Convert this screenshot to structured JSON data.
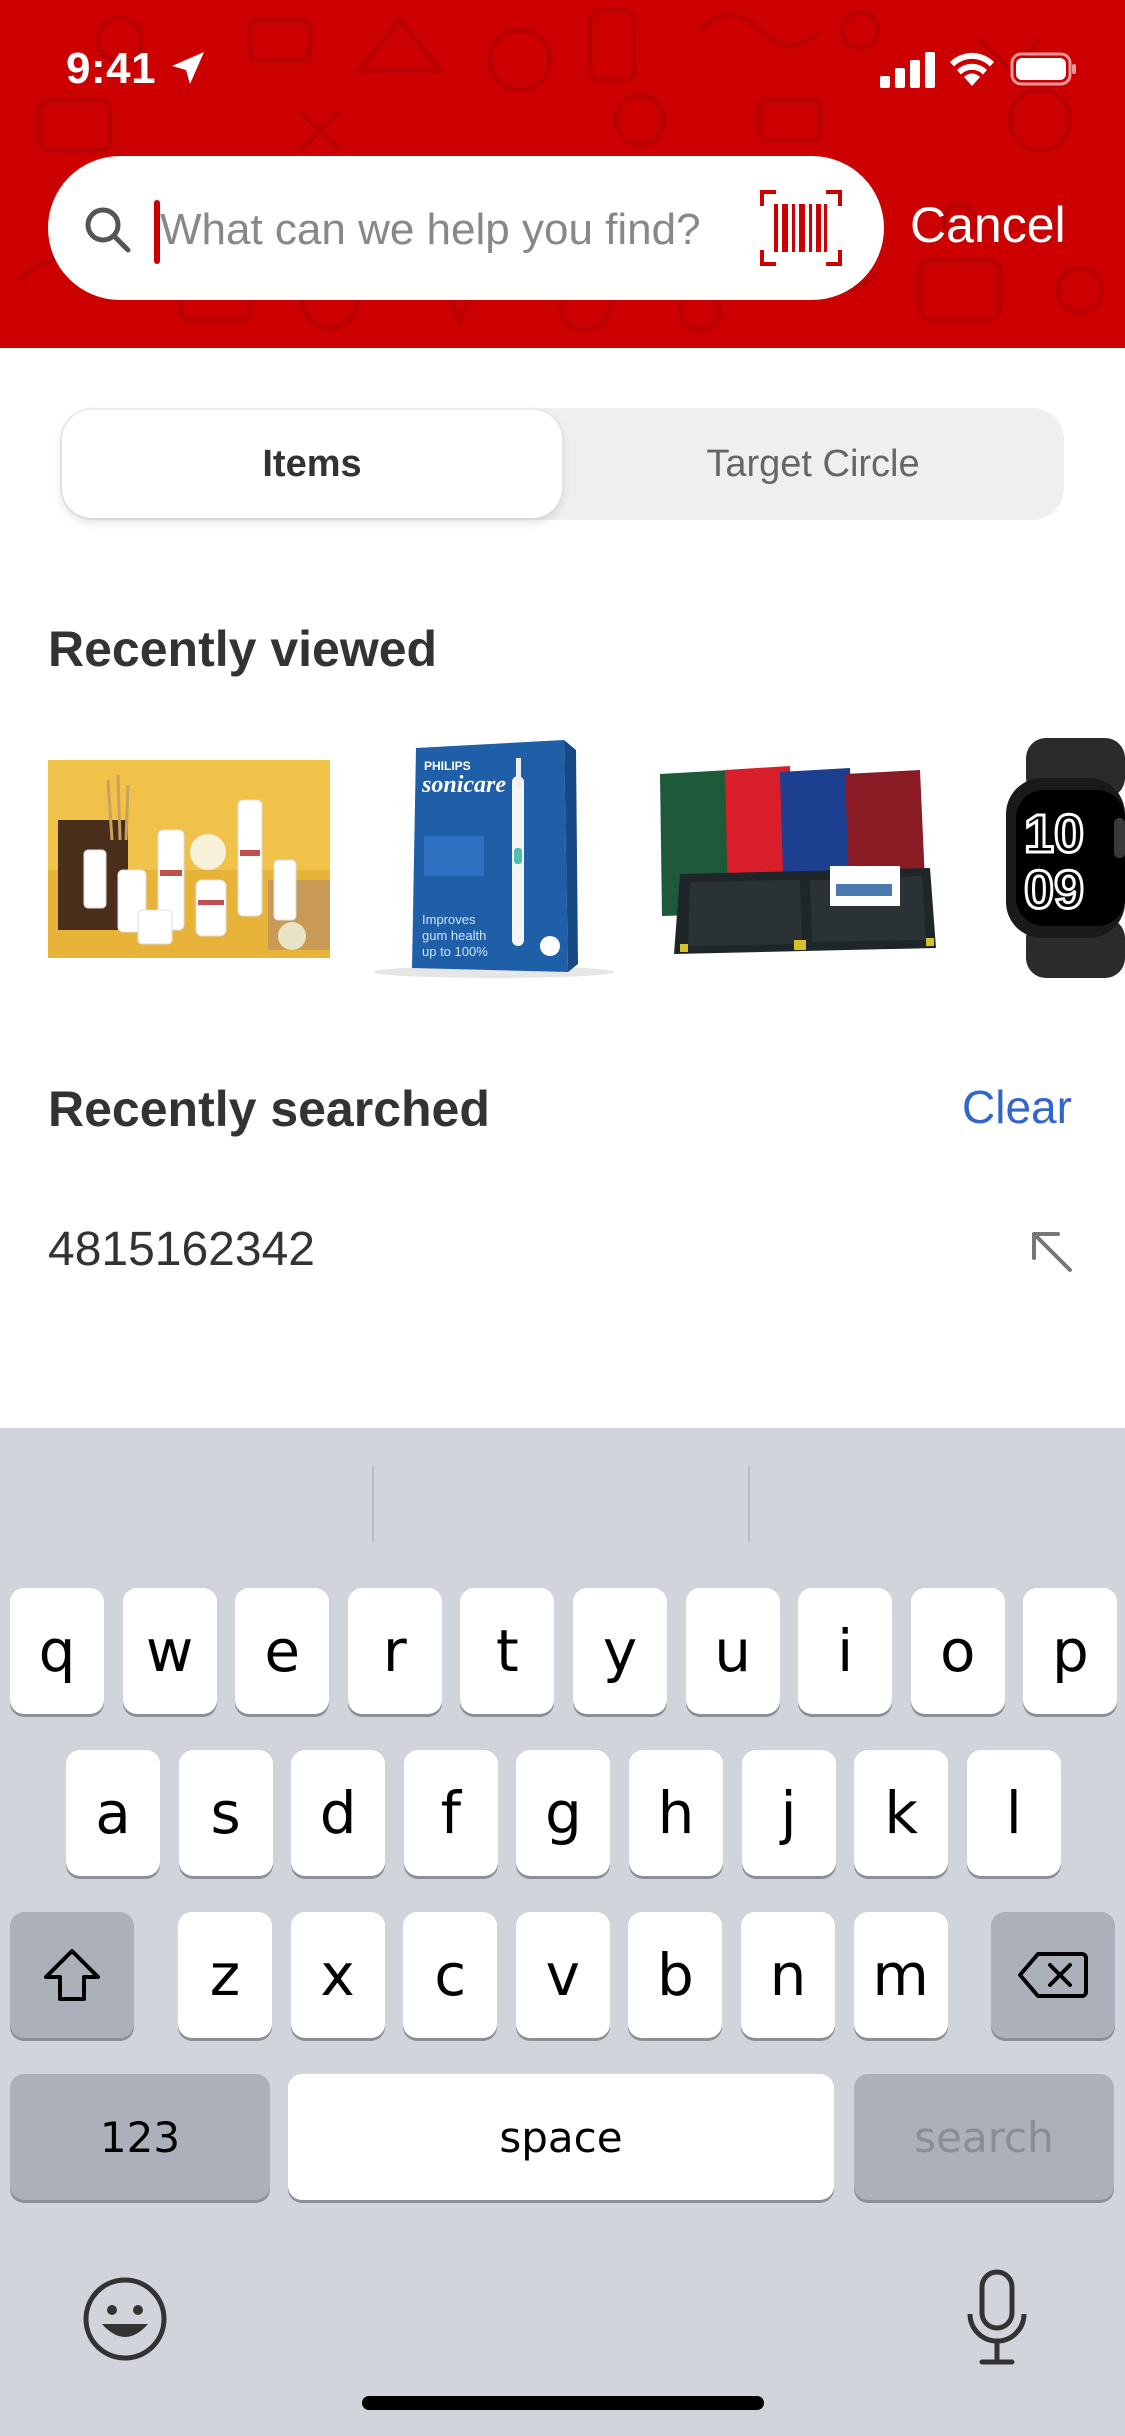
{
  "status_bar": {
    "time": "9:41"
  },
  "search": {
    "placeholder": "What can we help you find?",
    "value": "",
    "cancel_label": "Cancel"
  },
  "segment": {
    "items_label": "Items",
    "target_circle_label": "Target Circle",
    "selected": "Items"
  },
  "recently_viewed": {
    "title": "Recently viewed",
    "items": [
      {
        "name": "thumb-skincare-products"
      },
      {
        "name": "thumb-philips-sonicare"
      },
      {
        "name": "thumb-presentation-folders"
      },
      {
        "name": "thumb-smartwatch"
      }
    ],
    "sonicare_box_text": [
      "PHILIPS",
      "sonicare",
      "Improves",
      "gum health",
      "up to 100%"
    ],
    "watch_text": [
      "10",
      "09"
    ]
  },
  "recently_searched": {
    "title": "Recently searched",
    "clear_label": "Clear",
    "queries": [
      "4815162342"
    ]
  },
  "keyboard": {
    "row1": [
      "q",
      "w",
      "e",
      "r",
      "t",
      "y",
      "u",
      "i",
      "o",
      "p"
    ],
    "row2": [
      "a",
      "s",
      "d",
      "f",
      "g",
      "h",
      "j",
      "k",
      "l"
    ],
    "row3": [
      "z",
      "x",
      "c",
      "v",
      "b",
      "n",
      "m"
    ],
    "numbers_label": "123",
    "space_label": "space",
    "search_label": "search"
  },
  "colors": {
    "brand_red": "#cc0000",
    "link_blue": "#3366cc",
    "keyboard_bg": "#d1d4da"
  }
}
